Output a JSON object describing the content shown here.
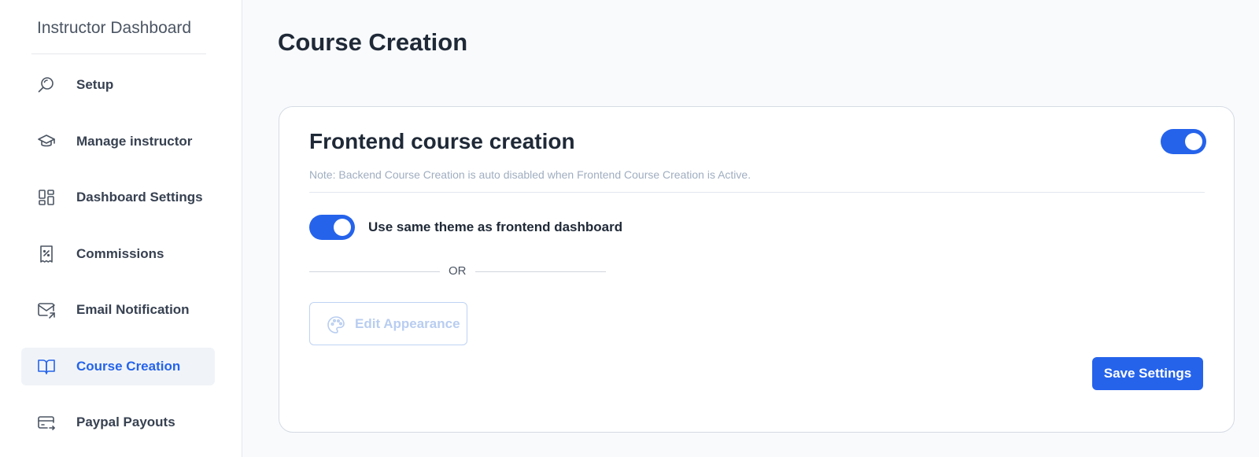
{
  "sidebar": {
    "title": "Instructor Dashboard",
    "items": [
      {
        "label": "Setup",
        "icon": "search-icon"
      },
      {
        "label": "Manage instructor",
        "icon": "graduation-cap-icon"
      },
      {
        "label": "Dashboard Settings",
        "icon": "dashboard-grid-icon"
      },
      {
        "label": "Commissions",
        "icon": "receipt-percent-icon"
      },
      {
        "label": "Email Notification",
        "icon": "mail-send-icon"
      },
      {
        "label": "Course Creation",
        "icon": "open-book-icon",
        "active": true
      },
      {
        "label": "Paypal Payouts",
        "icon": "card-transfer-icon"
      }
    ]
  },
  "main": {
    "page_title": "Course Creation",
    "card": {
      "title": "Frontend course creation",
      "note": "Note: Backend Course Creation is auto disabled when Frontend Course Creation is Active.",
      "frontend_enabled": true,
      "theme_toggle_label": "Use same theme as frontend dashboard",
      "theme_toggle_on": true,
      "or_text": "OR",
      "edit_appearance_label": "Edit Appearance",
      "edit_appearance_icon": "palette-icon",
      "save_label": "Save Settings"
    }
  },
  "colors": {
    "accent": "#2563eb",
    "active_bg": "#f0f4f8",
    "disabled": "#b8cdf0"
  }
}
